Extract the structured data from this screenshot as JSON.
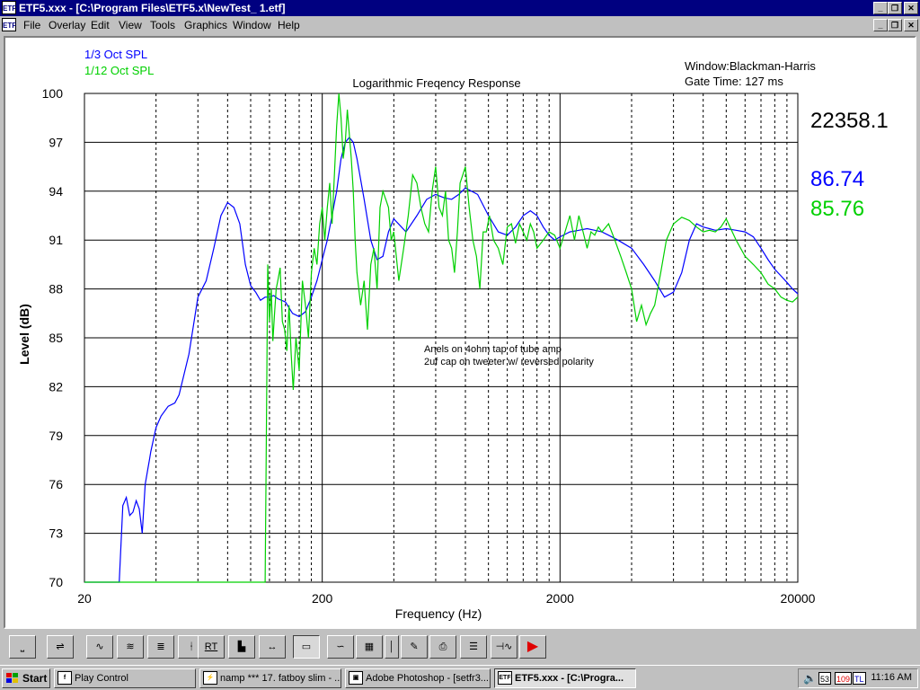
{
  "window": {
    "app_icon": "ETF",
    "title": "ETF5.xxx - [C:\\Program Files\\ETF5.x\\NewTest_ 1.etf]",
    "controls": [
      "minimize",
      "restore",
      "close"
    ]
  },
  "menubar": {
    "doc_icon": "ETF",
    "items": [
      {
        "label": "File"
      },
      {
        "label": "Overlay"
      },
      {
        "label": "Edit"
      },
      {
        "label": "View"
      },
      {
        "label": "Tools"
      },
      {
        "label": "Graphics"
      },
      {
        "label": "Window"
      },
      {
        "label": "Help"
      }
    ]
  },
  "graph": {
    "legend": [
      "1/3 Oct SPL",
      "1/12 Oct SPL"
    ],
    "window_info": "Window:Blackman-Harris",
    "gate_info": "Gate Time:  127 ms",
    "readout_freq": "22358.1",
    "readout_blue": "86.74",
    "readout_green": "85.76",
    "annotation_line1": "Anels on 4ohm tap of tube amp",
    "annotation_line2": "2uf cap on tweeter w/ reversed polarity"
  },
  "chart_data": {
    "type": "line",
    "title": "Logarithmic Freqency Response",
    "xlabel": "Frequency (Hz)",
    "ylabel": "Level (dB)",
    "xscale": "log",
    "xlim": [
      20,
      20000
    ],
    "ylim": [
      70,
      100
    ],
    "xticks": [
      "20",
      "200",
      "2000",
      "20000"
    ],
    "yticks": [
      "100",
      "97",
      "94",
      "91",
      "88",
      "85",
      "82",
      "79",
      "76",
      "73",
      "70"
    ],
    "grid": true,
    "colors": {
      "blue": "#0000ff",
      "green": "#00d000"
    },
    "series": [
      {
        "name": "1/3 Oct SPL",
        "color": "#0000ff",
        "x": [
          20,
          28,
          29,
          30,
          31,
          32,
          33,
          34,
          35,
          36,
          37,
          37.5,
          38,
          40,
          42,
          45,
          48,
          50,
          55,
          60,
          65,
          70,
          75,
          80,
          85,
          90,
          95,
          100,
          105,
          110,
          115,
          120,
          125,
          130,
          140,
          150,
          160,
          170,
          180,
          190,
          200,
          210,
          220,
          230,
          240,
          250,
          260,
          270,
          280,
          300,
          320,
          340,
          360,
          380,
          400,
          450,
          500,
          550,
          600,
          650,
          700,
          750,
          800,
          900,
          1000,
          1100,
          1200,
          1300,
          1400,
          1500,
          1600,
          1700,
          1800,
          1900,
          2000,
          2200,
          2400,
          2600,
          2800,
          3000,
          3200,
          3500,
          4000,
          4500,
          5000,
          5500,
          6000,
          6500,
          7000,
          7500,
          8000,
          8500,
          9000,
          10000,
          11000,
          12000,
          13000,
          14000,
          15000,
          16000,
          17000,
          18000,
          19000,
          20000
        ],
        "y": [
          70,
          70,
          74.7,
          75.2,
          74.1,
          74.3,
          75.0,
          74.5,
          73.0,
          76.0,
          77.0,
          77.5,
          78.0,
          79.5,
          80.2,
          80.8,
          81.0,
          81.5,
          84.0,
          87.5,
          88.5,
          90.5,
          92.5,
          93.3,
          93.0,
          92.0,
          89.5,
          88.2,
          87.8,
          87.3,
          87.5,
          87.5,
          87.6,
          87.4,
          87.2,
          86.5,
          86.3,
          86.6,
          87.5,
          88.5,
          89.8,
          91.0,
          92.5,
          94.0,
          96.0,
          97.0,
          97.3,
          97.0,
          96.0,
          93.5,
          91.0,
          89.8,
          90.0,
          91.5,
          92.3,
          91.5,
          92.5,
          93.5,
          93.8,
          93.6,
          93.5,
          93.8,
          94.2,
          93.8,
          92.5,
          91.5,
          91.3,
          91.8,
          92.5,
          92.8,
          92.5,
          91.8,
          91.3,
          91.0,
          91.2,
          91.5,
          91.6,
          91.7,
          91.6,
          91.5,
          91.3,
          91.0,
          90.5,
          89.5,
          88.5,
          87.5,
          87.8,
          89.0,
          91.0,
          92.0,
          91.8,
          91.7,
          91.6,
          91.7,
          91.6,
          91.5,
          91.2,
          90.5,
          89.8,
          89.2,
          88.8,
          88.4,
          88.0,
          87.7
        ]
      },
      {
        "name": "1/12 Oct SPL",
        "color": "#00d000",
        "x": [
          20,
          115,
          116,
          118,
          120,
          122,
          124,
          126,
          128,
          130,
          133,
          136,
          139,
          142,
          145,
          148,
          151,
          155,
          160,
          165,
          170,
          175,
          180,
          185,
          190,
          195,
          200,
          205,
          210,
          215,
          220,
          225,
          230,
          235,
          240,
          245,
          250,
          255,
          260,
          265,
          270,
          275,
          280,
          290,
          300,
          310,
          320,
          330,
          340,
          350,
          360,
          370,
          380,
          390,
          400,
          420,
          440,
          460,
          480,
          500,
          520,
          540,
          560,
          580,
          600,
          620,
          640,
          660,
          680,
          700,
          720,
          740,
          760,
          780,
          800,
          830,
          860,
          890,
          920,
          950,
          980,
          1010,
          1050,
          1100,
          1150,
          1200,
          1250,
          1300,
          1350,
          1400,
          1450,
          1500,
          1550,
          1600,
          1700,
          1800,
          1900,
          2000,
          2100,
          2200,
          2300,
          2400,
          2500,
          2600,
          2700,
          2800,
          2900,
          3000,
          3200,
          3400,
          3600,
          3800,
          4000,
          4200,
          4400,
          4600,
          4800,
          5000,
          5300,
          5600,
          6000,
          6500,
          7000,
          7500,
          8000,
          8500,
          9000,
          9500,
          10000,
          11000,
          12000,
          13000,
          14000,
          15000,
          16000,
          17000,
          18000,
          19000,
          20000
        ],
        "y": [
          70,
          70,
          76.5,
          89.5,
          86.0,
          88.0,
          84.8,
          86.5,
          88.0,
          88.5,
          89.3,
          86.0,
          85.5,
          84.2,
          87.0,
          84.0,
          81.8,
          85.0,
          83.0,
          88.5,
          87.0,
          85.0,
          89.0,
          90.5,
          89.5,
          92.0,
          93.0,
          91.0,
          93.0,
          94.5,
          92.0,
          95.0,
          98.0,
          100.0,
          98.5,
          96.0,
          97.0,
          99.0,
          97.5,
          96.0,
          94.0,
          91.0,
          89.0,
          87.0,
          88.5,
          85.5,
          89.5,
          90.5,
          88.0,
          93.0,
          94.0,
          93.5,
          93.0,
          91.0,
          91.5,
          88.5,
          90.5,
          92.5,
          95.0,
          94.5,
          93.0,
          92.0,
          91.5,
          94.0,
          95.5,
          93.0,
          92.5,
          94.0,
          91.0,
          90.5,
          89.0,
          91.5,
          94.5,
          95.0,
          95.5,
          93.0,
          91.0,
          90.0,
          88.0,
          91.5,
          91.5,
          92.5,
          91.0,
          90.5,
          89.5,
          91.8,
          92.0,
          90.8,
          92.0,
          91.5,
          91.0,
          92.0,
          91.5,
          90.5,
          91.0,
          91.5,
          91.3,
          90.5,
          91.5,
          92.5,
          91.0,
          92.5,
          91.5,
          90.5,
          91.5,
          91.3,
          91.8,
          91.5,
          92.0,
          91.0,
          90.0,
          89.0,
          88.0,
          86.0,
          87.0,
          85.8,
          86.5,
          87.0,
          89.0,
          91.0,
          92.0,
          92.4,
          92.2,
          91.8,
          91.5,
          91.6,
          91.5,
          91.8,
          92.3,
          91.0,
          90.0,
          89.5,
          89.0,
          88.3,
          88.0,
          87.5,
          87.3,
          87.2,
          87.5
        ]
      }
    ]
  },
  "toolbar": {
    "buttons": [
      {
        "name": "baseline-tool",
        "label": "⎵",
        "pressed": false
      },
      {
        "name": "level-slider-tool",
        "label": "⇌",
        "pressed": false
      },
      {
        "name": "impulse-tool",
        "label": "∿",
        "pressed": false
      },
      {
        "name": "waterfall-tool",
        "label": "≋",
        "pressed": false
      },
      {
        "name": "multi-plot-tool",
        "label": "≣",
        "pressed": false
      },
      {
        "name": "marker-tool",
        "label": "ᚽ",
        "pressed": false
      },
      {
        "name": "rt-tool",
        "label": "RT",
        "pressed": false
      },
      {
        "name": "bar-graph-tool",
        "label": "▙",
        "pressed": false
      },
      {
        "name": "cursor-range-tool",
        "label": "↔",
        "pressed": false
      },
      {
        "name": "response-tool",
        "label": "▭",
        "pressed": true
      },
      {
        "name": "phase-tool",
        "label": "∽",
        "pressed": false
      },
      {
        "name": "spectrum-tool",
        "label": "▦",
        "pressed": false
      },
      {
        "name": "divider-tool",
        "label": "│",
        "pressed": false
      },
      {
        "name": "color-tool",
        "label": "✎",
        "pressed": false
      },
      {
        "name": "print-tool",
        "label": "⎙",
        "pressed": false
      },
      {
        "name": "notes-tool",
        "label": "☰",
        "pressed": false
      },
      {
        "name": "signal-tool",
        "label": "⊣∿",
        "pressed": false
      },
      {
        "name": "record-tool",
        "label": "▶",
        "pressed": false
      }
    ]
  },
  "taskbar": {
    "start_label": "Start",
    "tasks": [
      {
        "label": "Play Control",
        "active": false
      },
      {
        "label": "namp *** 17. fatboy slim - ...",
        "active": false
      },
      {
        "label": "Adobe Photoshop - [setfr3...",
        "active": false
      },
      {
        "label": "ETF5.xxx - [C:\\Progra...",
        "active": true
      }
    ],
    "tray_items": [
      "53",
      "109",
      "TL"
    ],
    "clock": "11:16 AM"
  }
}
